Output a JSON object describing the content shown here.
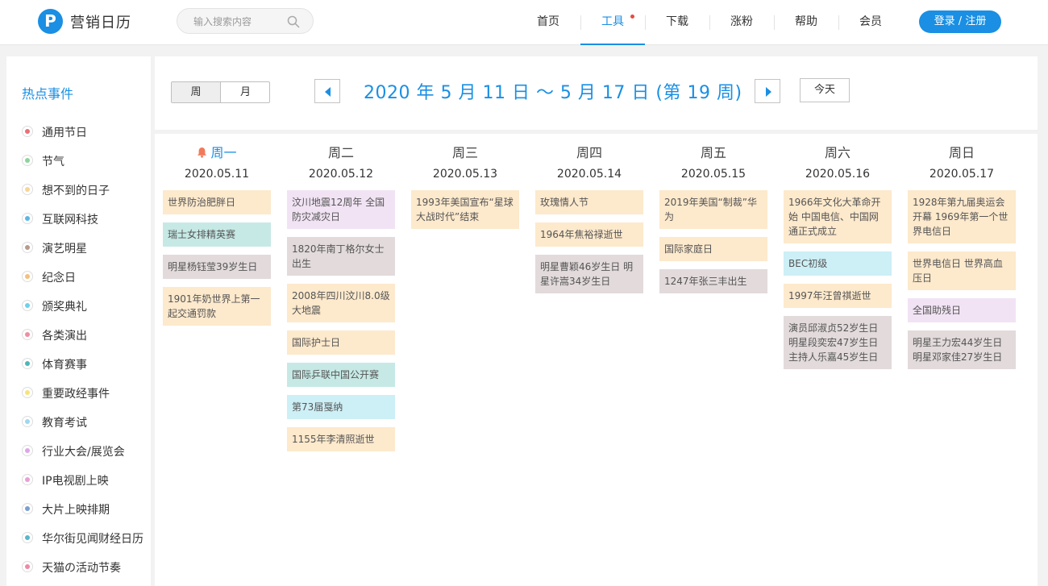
{
  "header": {
    "logo_letter": "P",
    "title": "营销日历",
    "search_placeholder": "输入搜索内容",
    "nav": [
      {
        "label": "首页"
      },
      {
        "label": "工具"
      },
      {
        "label": "下载"
      },
      {
        "label": "涨粉"
      },
      {
        "label": "帮助"
      },
      {
        "label": "会员"
      }
    ],
    "login_label": "登录 / 注册"
  },
  "sidebar": {
    "title": "热点事件",
    "categories": [
      {
        "label": "通用节日",
        "color": "#e8707a"
      },
      {
        "label": "节气",
        "color": "#8fd39b"
      },
      {
        "label": "想不到的日子",
        "color": "#f7d49a"
      },
      {
        "label": "互联网科技",
        "color": "#5bb7e6"
      },
      {
        "label": "演艺明星",
        "color": "#b79a8f"
      },
      {
        "label": "纪念日",
        "color": "#f5c07a"
      },
      {
        "label": "颁奖典礼",
        "color": "#6fd1e8"
      },
      {
        "label": "各类演出",
        "color": "#ee8ea0"
      },
      {
        "label": "体育赛事",
        "color": "#4fb6b6"
      },
      {
        "label": "重要政经事件",
        "color": "#f7e37a"
      },
      {
        "label": "教育考试",
        "color": "#9fd7ef"
      },
      {
        "label": "行业大会/展览会",
        "color": "#dca7e6"
      },
      {
        "label": "IP电视剧上映",
        "color": "#e8a0d6"
      },
      {
        "label": "大片上映排期",
        "color": "#7b9fd1"
      },
      {
        "label": "华尔街见闻财经日历",
        "color": "#5ab6c9"
      },
      {
        "label": "天猫の活动节奏",
        "color": "#ec8aa6"
      }
    ]
  },
  "toolbar": {
    "week_label": "周",
    "month_label": "月",
    "week_title": "2020 年 5 月 11 日 ～ 5 月 17 日  (第 19 周)",
    "today_label": "今天"
  },
  "days": [
    {
      "name": "周一",
      "date": "2020.05.11",
      "today": true,
      "events": [
        {
          "text": "世界防治肥胖日",
          "color": "orange"
        },
        {
          "text": "瑞士女排精英赛",
          "color": "teal"
        },
        {
          "text": "明星杨钰莹39岁生日",
          "color": "grey"
        },
        {
          "text": "1901年奶世界上第一起交通罚款",
          "color": "orange"
        }
      ]
    },
    {
      "name": "周二",
      "date": "2020.05.12",
      "today": false,
      "events": [
        {
          "text": "汶川地震12周年 全国防灾减灾日",
          "color": "purple"
        },
        {
          "text": "1820年南丁格尔女士出生",
          "color": "grey"
        },
        {
          "text": "2008年四川汶川8.0级大地震",
          "color": "orange"
        },
        {
          "text": "国际护士日",
          "color": "orange"
        },
        {
          "text": "国际乒联中国公开赛",
          "color": "teal"
        },
        {
          "text": "第73届戛纳",
          "color": "cyan"
        },
        {
          "text": "1155年李清照逝世",
          "color": "orange"
        }
      ]
    },
    {
      "name": "周三",
      "date": "2020.05.13",
      "today": false,
      "events": [
        {
          "text": "1993年美国宣布“星球大战时代”结束",
          "color": "orange"
        }
      ]
    },
    {
      "name": "周四",
      "date": "2020.05.14",
      "today": false,
      "events": [
        {
          "text": "玫瑰情人节",
          "color": "orange"
        },
        {
          "text": "1964年焦裕禄逝世",
          "color": "orange"
        },
        {
          "text": "明星曹颖46岁生日 明星许嵩34岁生日",
          "color": "grey"
        }
      ]
    },
    {
      "name": "周五",
      "date": "2020.05.15",
      "today": false,
      "events": [
        {
          "text": "2019年美国“制裁”华为",
          "color": "orange"
        },
        {
          "text": "国际家庭日",
          "color": "orange"
        },
        {
          "text": "1247年张三丰出生",
          "color": "grey"
        }
      ]
    },
    {
      "name": "周六",
      "date": "2020.05.16",
      "today": false,
      "events": [
        {
          "text": "1966年文化大革命开始 中国电信、中国网通正式成立",
          "color": "orange"
        },
        {
          "text": "BEC初级",
          "color": "cyan"
        },
        {
          "text": "1997年汪曾祺逝世",
          "color": "orange"
        },
        {
          "text": "演员邱淑贞52岁生日 明星段奕宏47岁生日 主持人乐嘉45岁生日",
          "color": "grey"
        }
      ]
    },
    {
      "name": "周日",
      "date": "2020.05.17",
      "today": false,
      "events": [
        {
          "text": "1928年第九届奥运会开幕 1969年第一个世界电信日",
          "color": "orange"
        },
        {
          "text": "世界电信日 世界高血压日",
          "color": "orange"
        },
        {
          "text": "全国助残日",
          "color": "purple"
        },
        {
          "text": "明星王力宏44岁生日 明星邓家佳27岁生日",
          "color": "grey"
        }
      ]
    }
  ]
}
